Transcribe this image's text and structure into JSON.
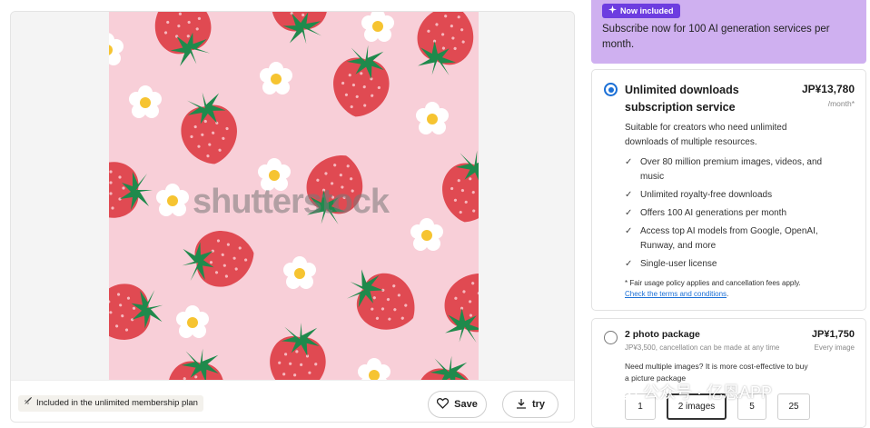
{
  "image": {
    "watermark": "shutterstock",
    "icons": {
      "pattern": "strawberry-flower-pattern"
    }
  },
  "toolbar": {
    "included_label": "Included in the unlimited membership plan",
    "save_label": "Save",
    "try_label": "try",
    "icons": {
      "included": "rocket-icon",
      "save": "heart-icon",
      "try": "download-icon"
    }
  },
  "promo": {
    "badge": "Now included",
    "text": "Subscribe now for 100 AI generation services per month.",
    "color": "#cfb0f0",
    "badge_color": "#6d3de0"
  },
  "plan": {
    "selected": true,
    "title": "Unlimited downloads subscription service",
    "price": "JP¥13,780",
    "period": "/month*",
    "description": "Suitable for creators who need unlimited downloads of multiple resources.",
    "features": [
      "Over 80 million premium images, videos, and music",
      "Unlimited royalty-free downloads",
      "Offers 100 AI generations per month",
      "Access top AI models from Google, OpenAI, Runway, and more",
      "Single-user license"
    ],
    "fine_print": "* Fair usage policy applies and cancellation fees apply.",
    "terms_link": "Check the terms and conditions",
    "terms_suffix": ".",
    "accent": "#1a6fd6"
  },
  "package": {
    "selected": false,
    "title": "2 photo package",
    "price": "JP¥1,750",
    "subtitle": "JP¥3,500, cancellation can be made at any time",
    "per": "Every image",
    "description": "Need multiple images? It is more cost-effective to buy a picture package",
    "quantities": [
      "1",
      "2 images",
      "5",
      "25"
    ],
    "selected_quantity": "2 images"
  },
  "overlay": {
    "wechat_text": "公众号 · 亿恩APP"
  }
}
